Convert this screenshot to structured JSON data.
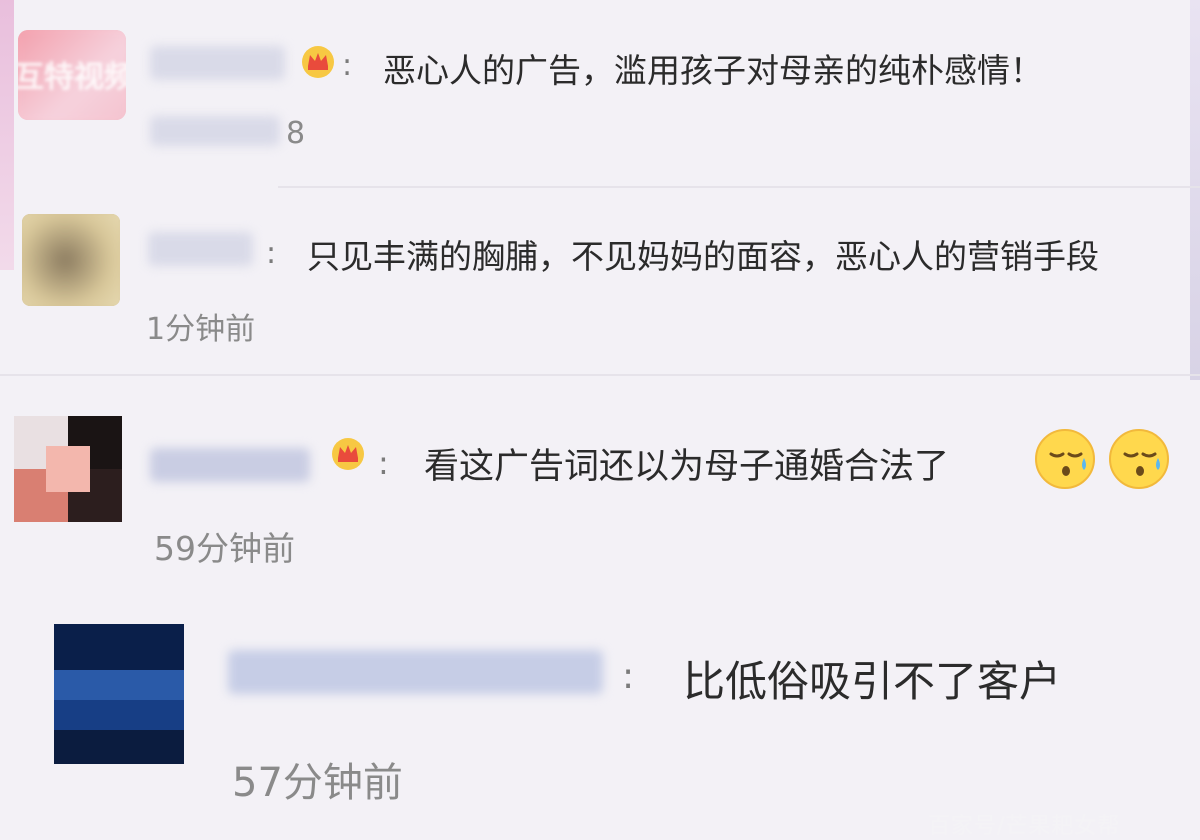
{
  "comments": [
    {
      "avatar_text": "互特视频",
      "text": "恶心人的广告，滥用孩子对母亲的纯朴感情！",
      "time_visible": "8"
    },
    {
      "text": "只见丰满的胸脯，不见妈妈的面容，恶心人的营销手段",
      "time": "1分钟前"
    },
    {
      "text": "看这广告词还以为母子通婚合法了",
      "time": "59分钟前"
    },
    {
      "text": "比低俗吸引不了客户",
      "time": "57分钟前"
    }
  ],
  "punctuation": {
    "colon": ":"
  },
  "watermark": "百家号/芒果耙女帮",
  "icons": {
    "crown": "crown-icon",
    "emoji": "sweat-face-emoji-icon"
  },
  "colors": {
    "background": "#f3f1f6",
    "text": "#2b2b2b",
    "time": "#8a8a8a",
    "crown": "#e94b3c"
  }
}
